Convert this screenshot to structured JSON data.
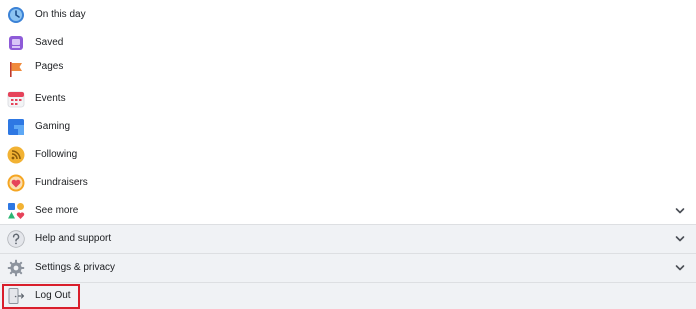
{
  "menu": {
    "items": [
      {
        "label": "On this day",
        "icon": "clock-icon"
      },
      {
        "label": "Saved",
        "icon": "bookmark-icon"
      },
      {
        "label": "Pages",
        "icon": "flag-icon"
      },
      {
        "label": "Events",
        "icon": "calendar-icon"
      },
      {
        "label": "Gaming",
        "icon": "gaming-icon"
      },
      {
        "label": "Following",
        "icon": "rss-icon"
      },
      {
        "label": "Fundraisers",
        "icon": "heart-icon"
      },
      {
        "label": "See more",
        "icon": "shapes-icon"
      }
    ],
    "help": {
      "label": "Help and support",
      "icon": "question-icon"
    },
    "settings": {
      "label": "Settings & privacy",
      "icon": "gear-icon"
    },
    "logout": {
      "label": "Log Out",
      "icon": "logout-icon"
    }
  },
  "colors": {
    "highlight": "#d91e2b",
    "section_bg": "#f0f2f5",
    "text": "#1c1e21"
  }
}
